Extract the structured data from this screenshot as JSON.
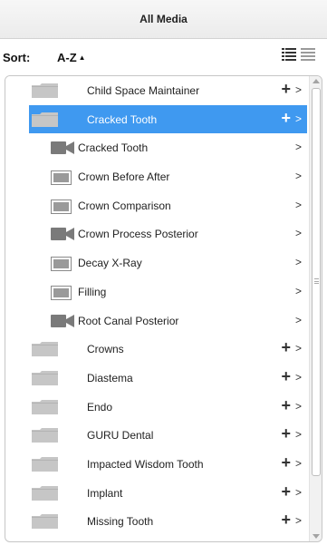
{
  "header": {
    "title": "All Media"
  },
  "sort": {
    "label": "Sort:",
    "value": "A-Z",
    "arrow": "▲"
  },
  "view_toggle": {
    "list_icon": "list-view-icon",
    "grid_icon": "grid-view-icon"
  },
  "colors": {
    "selected_bg": "#3f99f0",
    "folder_icon": "#c6c6c6",
    "media_icon": "#7a7a7a"
  },
  "items": [
    {
      "type": "folder",
      "label": "Child Space Maintainer",
      "plus": "+",
      "chevron": ">",
      "selected": false
    },
    {
      "type": "folder",
      "label": "Cracked Tooth",
      "plus": "+",
      "chevron": ">",
      "selected": true
    },
    {
      "type": "video",
      "label": "Cracked Tooth",
      "chevron": ">"
    },
    {
      "type": "image",
      "label": "Crown Before After",
      "chevron": ">"
    },
    {
      "type": "image",
      "label": "Crown Comparison",
      "chevron": ">"
    },
    {
      "type": "video",
      "label": "Crown Process Posterior",
      "chevron": ">"
    },
    {
      "type": "image",
      "label": "Decay X-Ray",
      "chevron": ">"
    },
    {
      "type": "image",
      "label": "Filling",
      "chevron": ">"
    },
    {
      "type": "video",
      "label": "Root Canal Posterior",
      "chevron": ">"
    },
    {
      "type": "folder",
      "label": "Crowns",
      "plus": "+",
      "chevron": ">",
      "selected": false
    },
    {
      "type": "folder",
      "label": "Diastema",
      "plus": "+",
      "chevron": ">",
      "selected": false
    },
    {
      "type": "folder",
      "label": "Endo",
      "plus": "+",
      "chevron": ">",
      "selected": false
    },
    {
      "type": "folder",
      "label": "GURU Dental",
      "plus": "+",
      "chevron": ">",
      "selected": false
    },
    {
      "type": "folder",
      "label": "Impacted Wisdom Tooth",
      "plus": "+",
      "chevron": ">",
      "selected": false
    },
    {
      "type": "folder",
      "label": "Implant",
      "plus": "+",
      "chevron": ">",
      "selected": false
    },
    {
      "type": "folder",
      "label": "Missing Tooth",
      "plus": "+",
      "chevron": ">",
      "selected": false
    }
  ]
}
